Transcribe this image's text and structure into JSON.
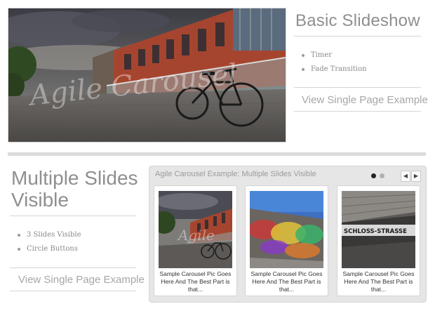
{
  "basic": {
    "title": "Basic Slideshow",
    "features": [
      "Timer",
      "Fade Transition"
    ],
    "link": "View Single Page Example",
    "watermark": "Agile Carousel"
  },
  "multiple": {
    "title_line1": "Multiple Slides",
    "title_line2": "Visible",
    "features": [
      "3 Slides Visible",
      "Circle Buttons"
    ],
    "link": "View Single Page Example"
  },
  "carousel": {
    "title": "Agile Carousel Example: Multiple Slides Visible",
    "prev_icon": "◀",
    "next_icon": "▶",
    "active_dot_color": "#222222",
    "inactive_dot_color": "#b0b0b0",
    "slides": [
      {
        "caption": "Sample Carousel Pic Goes Here And The Best Part is that...",
        "watermark": "Agile"
      },
      {
        "caption": "Sample Carousel Pic Goes Here And The Best Part is that...",
        "watermark": ""
      },
      {
        "caption": "Sample Carousel Pic Goes Here And The Best Part is that...",
        "watermark": "",
        "sign_text": "SCHLOSS-STRASSE"
      }
    ]
  },
  "colors": {
    "heading": "#8f8f8f",
    "rule": "#d5d5d5",
    "separator": "#dcdcdc",
    "carousel_bg": "#e6e6e6"
  }
}
